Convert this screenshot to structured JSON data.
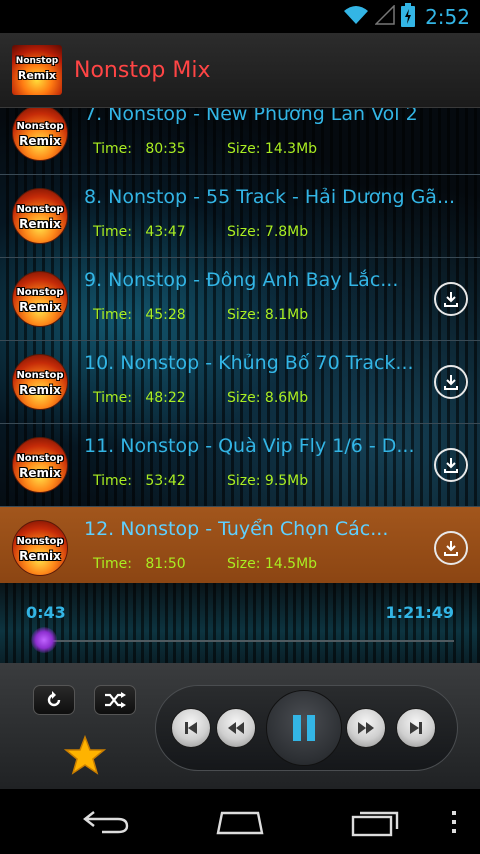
{
  "status_bar": {
    "time": "2:52",
    "icons": [
      "wifi-icon",
      "signal-icon",
      "battery-charging-icon"
    ]
  },
  "header": {
    "logo_line1": "Nonstop",
    "logo_line2": "Remix",
    "title": "Nonstop Mix"
  },
  "tracks": [
    {
      "title": "7. Nonstop - New Phương Lan Vol 2",
      "time_label": "Time:",
      "time": "80:35",
      "size_label": "Size:",
      "size": "14.3Mb",
      "logo_line1": "Nonstop",
      "logo_line2": "Remix",
      "download": false
    },
    {
      "title": "8. Nonstop - 55 Track - Hải Dương Gã...",
      "time_label": "Time:",
      "time": "43:47",
      "size_label": "Size:",
      "size": "7.8Mb",
      "logo_line1": "Nonstop",
      "logo_line2": "Remix",
      "download": false
    },
    {
      "title": "9. Nonstop - Đông Anh Bay Lắc...",
      "time_label": "Time:",
      "time": "45:28",
      "size_label": "Size:",
      "size": "8.1Mb",
      "logo_line1": "Nonstop",
      "logo_line2": "Remix",
      "download": true
    },
    {
      "title": "10. Nonstop - Khủng Bố 70 Track...",
      "time_label": "Time:",
      "time": "48:22",
      "size_label": "Size:",
      "size": "8.6Mb",
      "logo_line1": "Nonstop",
      "logo_line2": "Remix",
      "download": true
    },
    {
      "title": "11. Nonstop - Quà Vip Fly 1/6 - D...",
      "time_label": "Time:",
      "time": "53:42",
      "size_label": "Size:",
      "size": "9.5Mb",
      "logo_line1": "Nonstop",
      "logo_line2": "Remix",
      "download": true
    },
    {
      "title": "12. Nonstop - Tuyển Chọn Các...",
      "time_label": "Time:",
      "time": "81:50",
      "size_label": "Size:",
      "size": "14.5Mb",
      "logo_line1": "Nonstop",
      "logo_line2": "Remix",
      "download": true,
      "active": true
    }
  ],
  "player": {
    "elapsed": "0:43",
    "total": "1:21:49",
    "progress_fraction": 0.009
  },
  "controls": {
    "buttons": [
      "repeat-icon",
      "shuffle-icon",
      "star-icon",
      "skip-previous-icon",
      "rewind-icon",
      "pause-icon",
      "fast-forward-icon",
      "skip-next-icon"
    ]
  },
  "nav_bar": {
    "buttons": [
      "back-icon",
      "home-icon",
      "recent-apps-icon",
      "overflow-menu-icon"
    ]
  },
  "colors": {
    "accent": "#33b5e5",
    "title_red": "#ff4545",
    "meta_green": "#aaee22",
    "active_row": "#a2561c",
    "seek_purple": "#a13cd9",
    "star_yellow": "#ffb300"
  }
}
